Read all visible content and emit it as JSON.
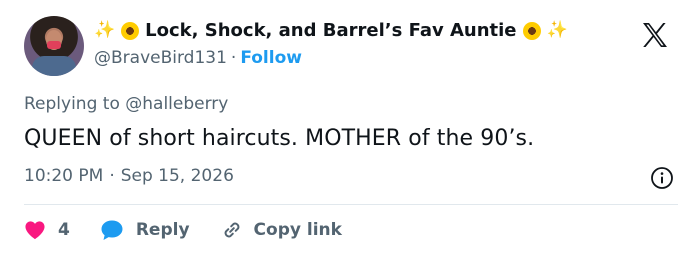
{
  "author": {
    "display_name": "Lock, Shock, and Barrel’s Fav Auntie",
    "handle": "@BraveBird131",
    "separator": "·",
    "follow_label": "Follow",
    "emojis": [
      "sparkles",
      "sunflower"
    ]
  },
  "reply_context": {
    "prefix": "Replying to",
    "mention": "@halleberry"
  },
  "tweet": {
    "text": "QUEEN of short haircuts. MOTHER of the 90’s.",
    "time": "10:20 PM",
    "separator": "·",
    "date": "Sep 15, 2026"
  },
  "actions": {
    "like_count": "4",
    "reply_label": "Reply",
    "copy_link_label": "Copy link"
  },
  "icons": {
    "brand": "x-logo-icon",
    "info": "info-icon",
    "like": "heart-icon",
    "reply": "speech-bubble-icon",
    "copy": "link-icon"
  },
  "colors": {
    "text": "#0f1419",
    "muted": "#536471",
    "accent": "#1d9bf0",
    "like": "#f91880"
  }
}
